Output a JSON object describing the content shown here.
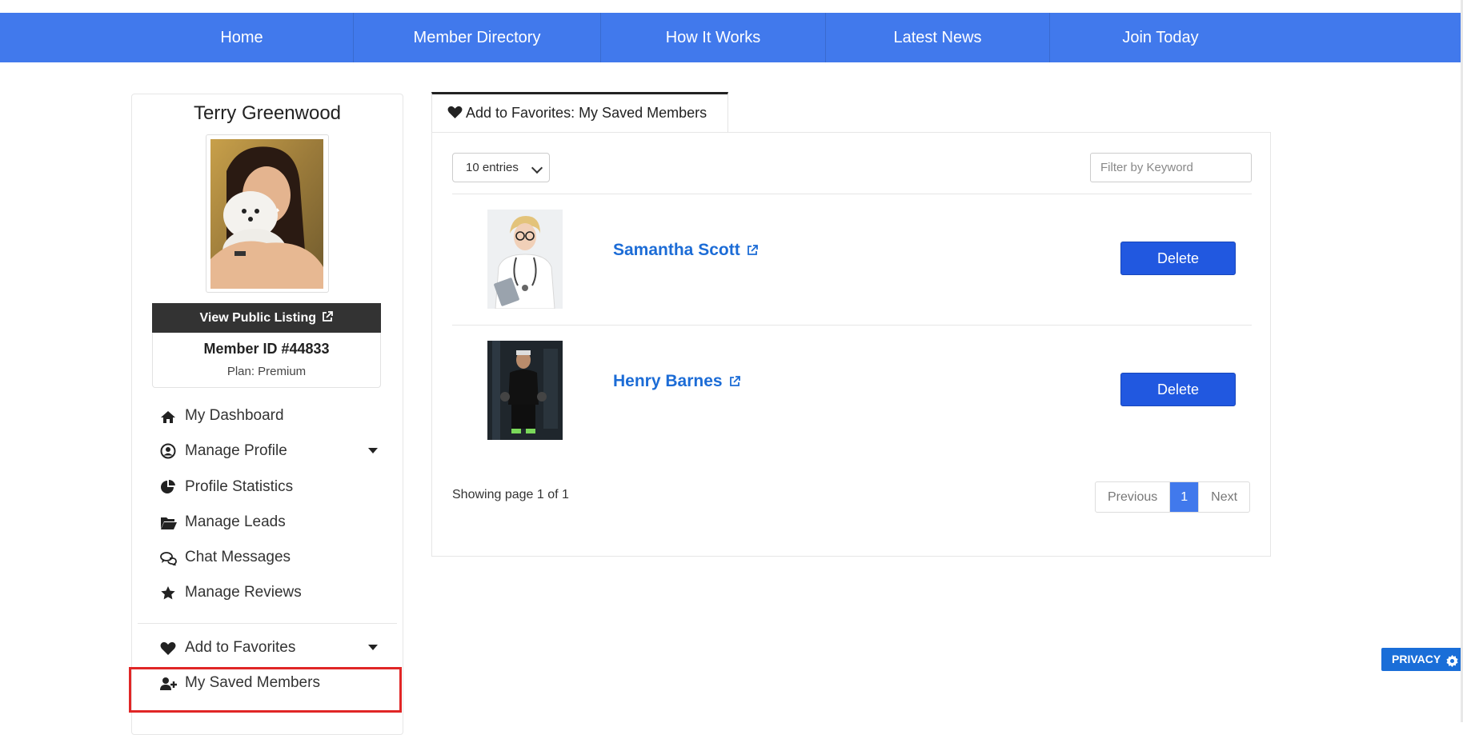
{
  "nav": {
    "items": [
      {
        "label": "Home"
      },
      {
        "label": "Member Directory"
      },
      {
        "label": "How It Works"
      },
      {
        "label": "Latest News"
      },
      {
        "label": "Join Today"
      }
    ]
  },
  "sidebar": {
    "name": "Terry Greenwood",
    "view_listing_label": "View Public Listing",
    "member_id": "Member ID #44833",
    "plan": "Plan: Premium",
    "menu": [
      {
        "label": "My Dashboard",
        "icon": "home-icon"
      },
      {
        "label": "Manage Profile",
        "icon": "user-circle-icon",
        "has_caret": true
      },
      {
        "label": "Profile Statistics",
        "icon": "pie-chart-icon"
      },
      {
        "label": "Manage Leads",
        "icon": "folder-open-icon"
      },
      {
        "label": "Chat Messages",
        "icon": "chat-bubbles-icon"
      },
      {
        "label": "Manage Reviews",
        "icon": "star-icon"
      },
      {
        "label": "Add to Favorites",
        "icon": "heart-icon",
        "has_caret": true
      },
      {
        "label": "My Saved Members",
        "icon": "user-plus-icon",
        "selected": true
      }
    ]
  },
  "main": {
    "tab_label": "Add to Favorites: My Saved Members",
    "entries_label": "10 entries",
    "filter_placeholder": "Filter by Keyword",
    "members": [
      {
        "name": "Samantha Scott",
        "delete_label": "Delete"
      },
      {
        "name": "Henry Barnes",
        "delete_label": "Delete"
      }
    ],
    "showing": "Showing page 1 of 1",
    "pager": {
      "previous": "Previous",
      "current": "1",
      "next": "Next"
    }
  },
  "privacy_label": "PRIVACY",
  "colors": {
    "nav_bg": "#4179ec",
    "link": "#1c6cd6",
    "delete_button": "#2158e0",
    "highlight": "#e02626",
    "privacy_bg": "#1a6ed8"
  }
}
